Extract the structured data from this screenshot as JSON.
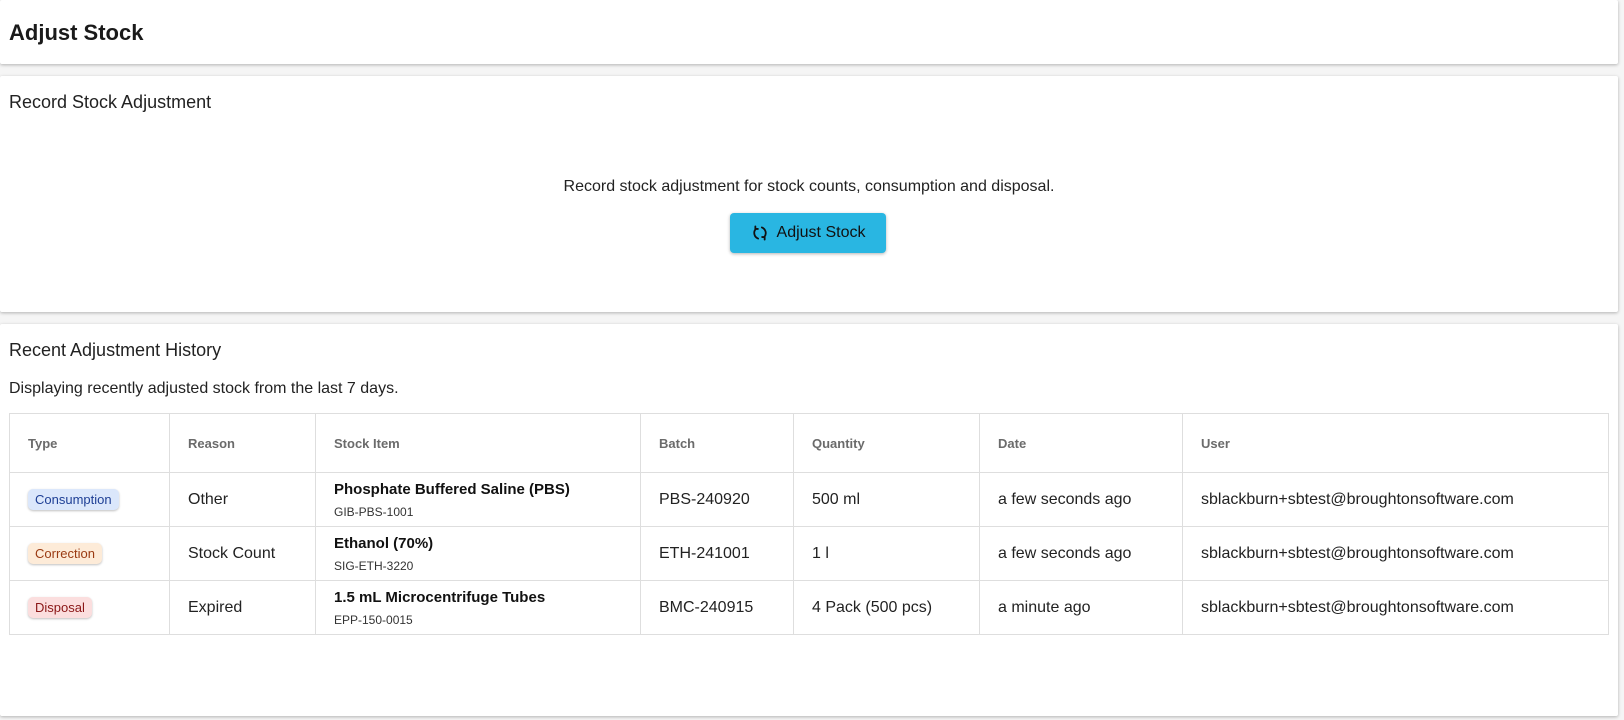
{
  "header": {
    "title": "Adjust Stock"
  },
  "record": {
    "title": "Record Stock Adjustment",
    "description": "Record stock adjustment for stock counts, consumption and disposal.",
    "button_label": "Adjust Stock",
    "button_icon": "refresh-icon",
    "button_color": "#29b6e2"
  },
  "history": {
    "title": "Recent Adjustment History",
    "description": "Displaying recently adjusted stock from the last 7 days.",
    "columns": [
      "Type",
      "Reason",
      "Stock Item",
      "Batch",
      "Quantity",
      "Date",
      "User"
    ],
    "rows": [
      {
        "type": "Consumption",
        "type_bg": "#dbe7fb",
        "type_color": "#1e3f95",
        "reason": "Other",
        "item_name": "Phosphate Buffered Saline (PBS)",
        "item_code": "GIB-PBS-1001",
        "batch": "PBS-240920",
        "quantity": "500 ml",
        "date": "a few seconds ago",
        "user": "sblackburn+sbtest@broughtonsoftware.com"
      },
      {
        "type": "Correction",
        "type_bg": "#fdebd8",
        "type_color": "#9a3a12",
        "reason": "Stock Count",
        "item_name": "Ethanol (70%)",
        "item_code": "SIG-ETH-3220",
        "batch": "ETH-241001",
        "quantity": "1 l",
        "date": "a few seconds ago",
        "user": "sblackburn+sbtest@broughtonsoftware.com"
      },
      {
        "type": "Disposal",
        "type_bg": "#fbdede",
        "type_color": "#8a1616",
        "reason": "Expired",
        "item_name": "1.5 mL Microcentrifuge Tubes",
        "item_code": "EPP-150-0015",
        "batch": "BMC-240915",
        "quantity": "4 Pack (500 pcs)",
        "date": "a minute ago",
        "user": "sblackburn+sbtest@broughtonsoftware.com"
      }
    ]
  }
}
